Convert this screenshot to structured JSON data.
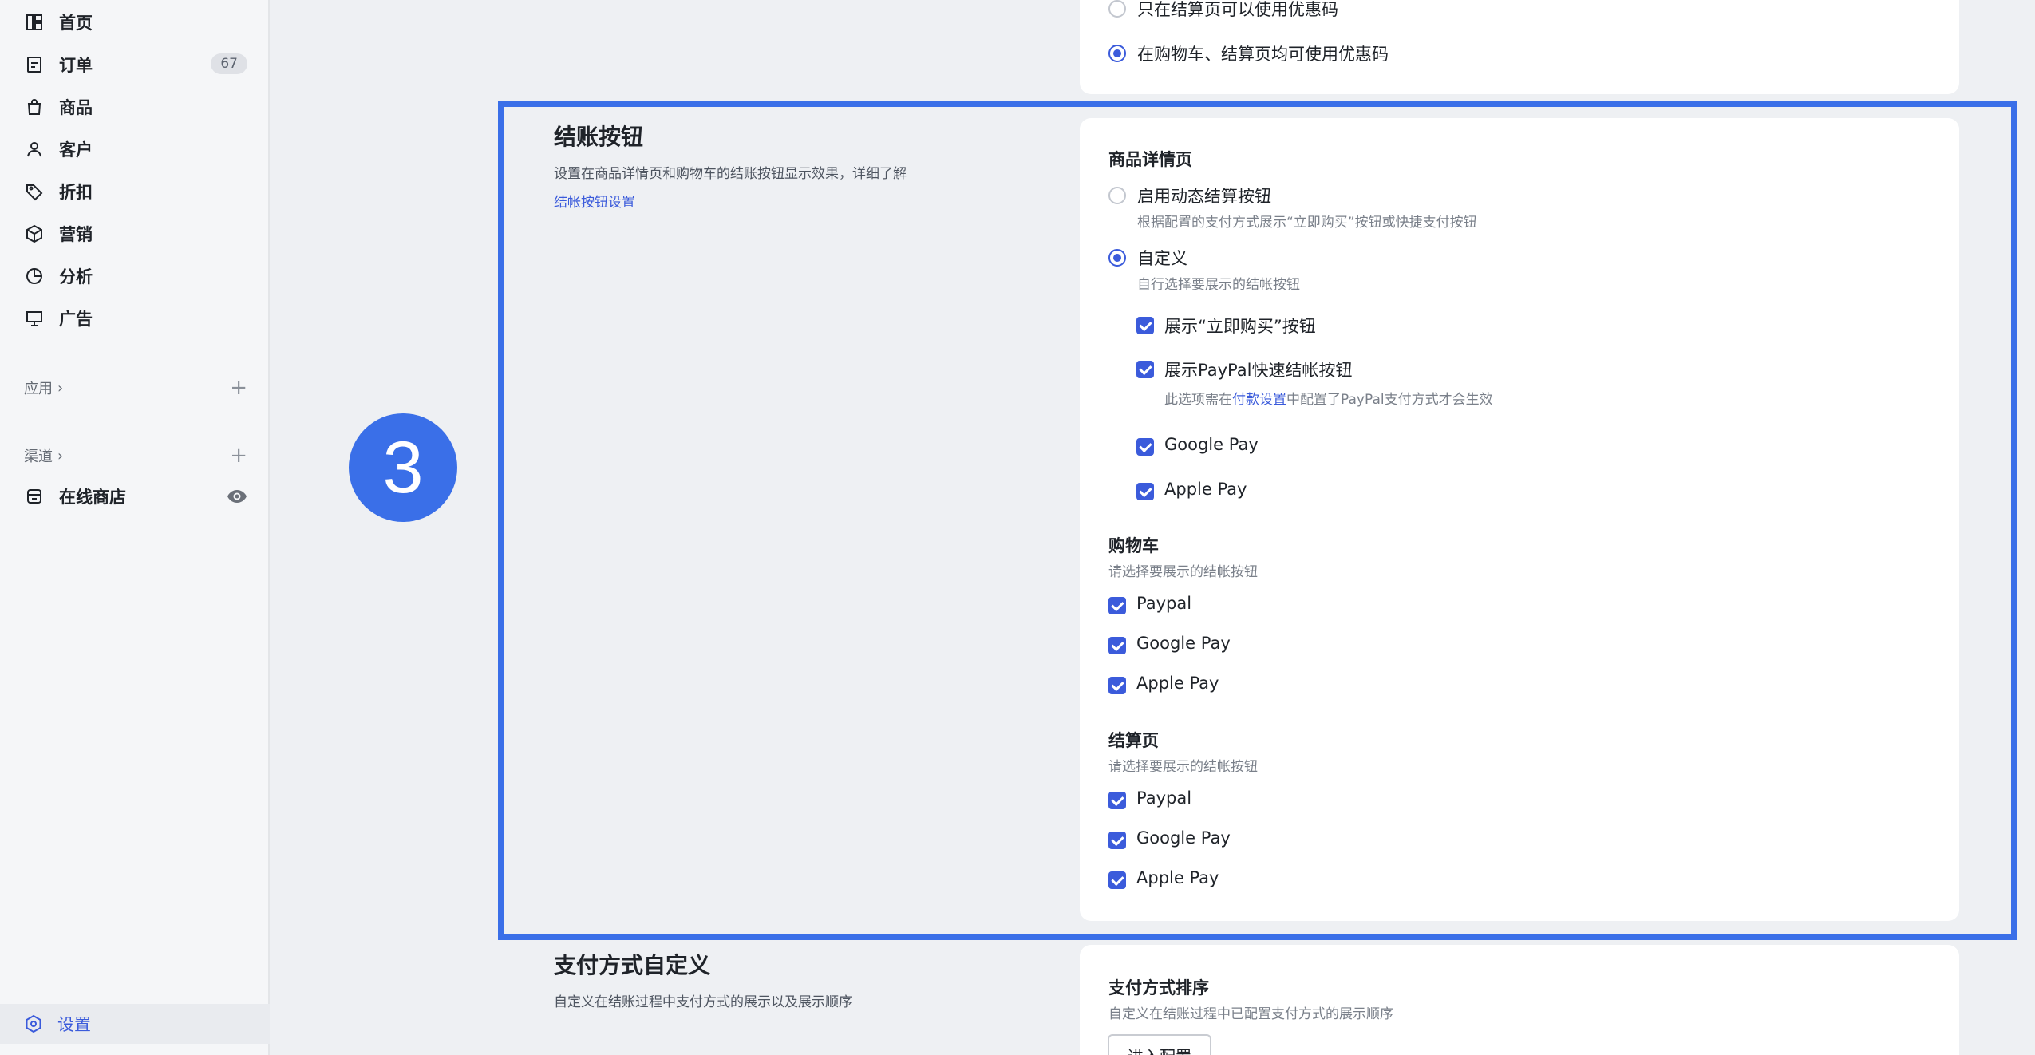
{
  "sidebar": {
    "items": [
      {
        "label": "首页",
        "icon": "dashboard-icon"
      },
      {
        "label": "订单",
        "icon": "orders-icon",
        "badge": "67"
      },
      {
        "label": "商品",
        "icon": "shopping-bag-icon"
      },
      {
        "label": "客户",
        "icon": "user-icon"
      },
      {
        "label": "折扣",
        "icon": "tag-icon"
      },
      {
        "label": "营销",
        "icon": "cube-icon"
      },
      {
        "label": "分析",
        "icon": "pie-chart-icon"
      },
      {
        "label": "广告",
        "icon": "billboard-icon"
      }
    ],
    "apps_label": "应用",
    "channels_label": "渠道",
    "online_store_label": "在线商店",
    "settings_label": "设置",
    "chevron": "›",
    "plus": "+"
  },
  "coupon": {
    "option1": "只在结算页可以使用优惠码",
    "option2": "在购物车、结算页均可使用优惠码"
  },
  "checkout_buttons": {
    "title": "结账按钮",
    "description": "设置在商品详情页和购物车的结账按钮显示效果，详细了解",
    "link": "结帐按钮设置",
    "product_page": {
      "heading": "商品详情页",
      "dynamic_label": "启用动态结算按钮",
      "dynamic_desc": "根据配置的支付方式展示“立即购买”按钮或快捷支付按钮",
      "custom_label": "自定义",
      "custom_desc": "自行选择要展示的结帐按钮",
      "buy_now": "展示“立即购买”按钮",
      "paypal_express": "展示PayPal快速结帐按钮",
      "paypal_note_pre": "此选项需在",
      "paypal_note_link": "付款设置",
      "paypal_note_post": "中配置了PayPal支付方式才会生效",
      "google_pay": "Google Pay",
      "apple_pay": "Apple Pay"
    },
    "cart": {
      "heading": "购物车",
      "desc": "请选择要展示的结帐按钮",
      "paypal": "Paypal",
      "google_pay": "Google Pay",
      "apple_pay": "Apple Pay"
    },
    "checkout_page": {
      "heading": "结算页",
      "desc": "请选择要展示的结帐按钮",
      "paypal": "Paypal",
      "google_pay": "Google Pay",
      "apple_pay": "Apple Pay"
    }
  },
  "payment_custom": {
    "title": "支付方式自定义",
    "description": "自定义在结账过程中支付方式的展示以及展示顺序",
    "sort_heading": "支付方式排序",
    "sort_desc": "自定义在结账过程中已配置支付方式的展示顺序",
    "enter_button": "进入配置"
  },
  "step_marker": "3",
  "colors": {
    "accent": "#3b5bdb",
    "highlight": "#3a6fe8"
  }
}
